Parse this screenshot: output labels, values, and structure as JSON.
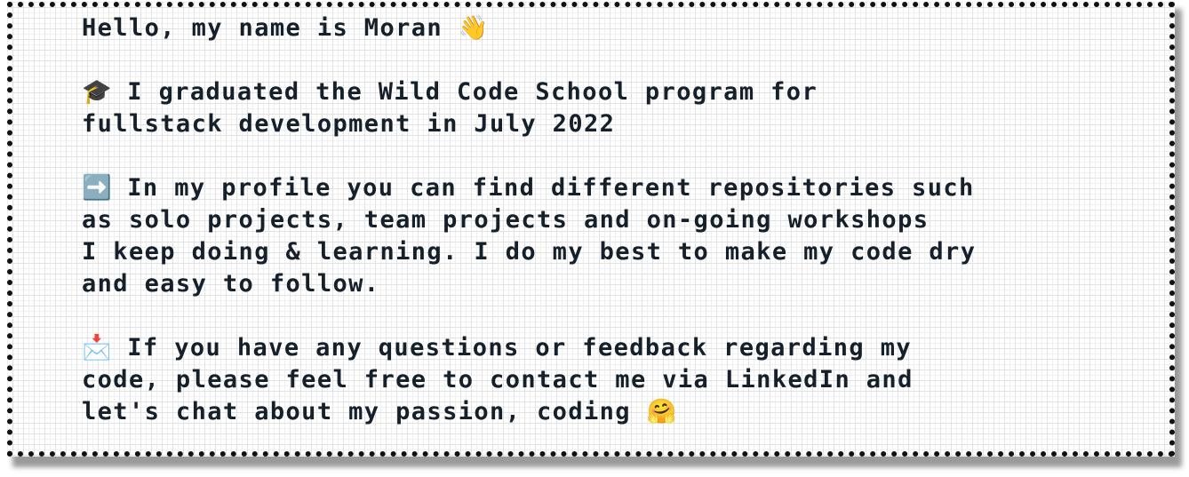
{
  "profile": {
    "greeting": {
      "text": "Hello, my name is Moran ",
      "emoji": "👋",
      "emoji_name": "waving-hand"
    },
    "education": {
      "emoji": "🎓",
      "emoji_name": "graduation-cap",
      "lines": [
        " I graduated the Wild Code School program for",
        "fullstack development in July 2022"
      ]
    },
    "repositories": {
      "emoji": "➡️",
      "emoji_name": "right-arrow",
      "lines": [
        " In my profile you can find different repositories such",
        "as solo projects, team projects and on-going workshops",
        "I keep doing & learning. I do my best to make my code dry",
        "and easy to follow."
      ]
    },
    "contact": {
      "emoji": "📩",
      "emoji_name": "envelope-with-arrow",
      "lines": [
        " If you have any questions or feedback regarding my",
        "code, please feel free to contact me via LinkedIn and",
        "let's chat about my passion, coding "
      ],
      "end_emoji": "🤗",
      "end_emoji_name": "hugging-face"
    }
  },
  "colors": {
    "text": "#15202b",
    "border": "#111111",
    "grid": "#e2e2e2",
    "background": "#ffffff"
  }
}
